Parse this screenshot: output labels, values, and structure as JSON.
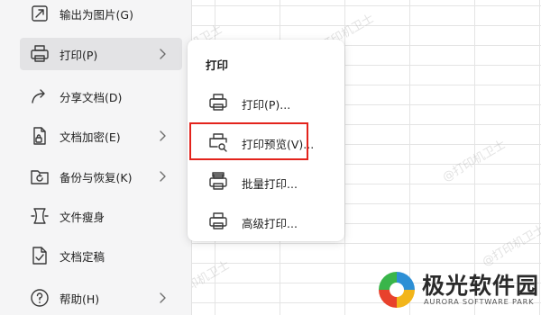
{
  "file_menu": {
    "items": [
      {
        "label": "输出为图片(G)",
        "icon": "export-image-icon",
        "has_submenu": false
      },
      {
        "label": "打印(P)",
        "icon": "printer-icon",
        "has_submenu": true,
        "active": true
      },
      {
        "label": "分享文档(D)",
        "icon": "share-icon",
        "has_submenu": false
      },
      {
        "label": "文档加密(E)",
        "icon": "document-lock-icon",
        "has_submenu": true
      },
      {
        "label": "备份与恢复(K)",
        "icon": "backup-restore-icon",
        "has_submenu": true
      },
      {
        "label": "文件瘦身",
        "icon": "file-slim-icon",
        "has_submenu": false
      },
      {
        "label": "文档定稿",
        "icon": "document-finalize-icon",
        "has_submenu": false
      },
      {
        "label": "帮助(H)",
        "icon": "help-icon",
        "has_submenu": true
      }
    ]
  },
  "print_submenu": {
    "title": "打印",
    "items": [
      {
        "label": "打印(P)...",
        "icon": "printer-icon"
      },
      {
        "label": "打印预览(V)...",
        "icon": "print-preview-icon",
        "highlighted": true
      },
      {
        "label": "批量打印...",
        "icon": "batch-print-icon"
      },
      {
        "label": "高级打印...",
        "icon": "advanced-print-icon"
      }
    ]
  },
  "highlight_color": "#e3231c",
  "watermark": {
    "text": "@打印机卫士"
  },
  "brand": {
    "name_cn": "极光软件园",
    "name_en": "AURORA SOFTWARE PARK"
  }
}
